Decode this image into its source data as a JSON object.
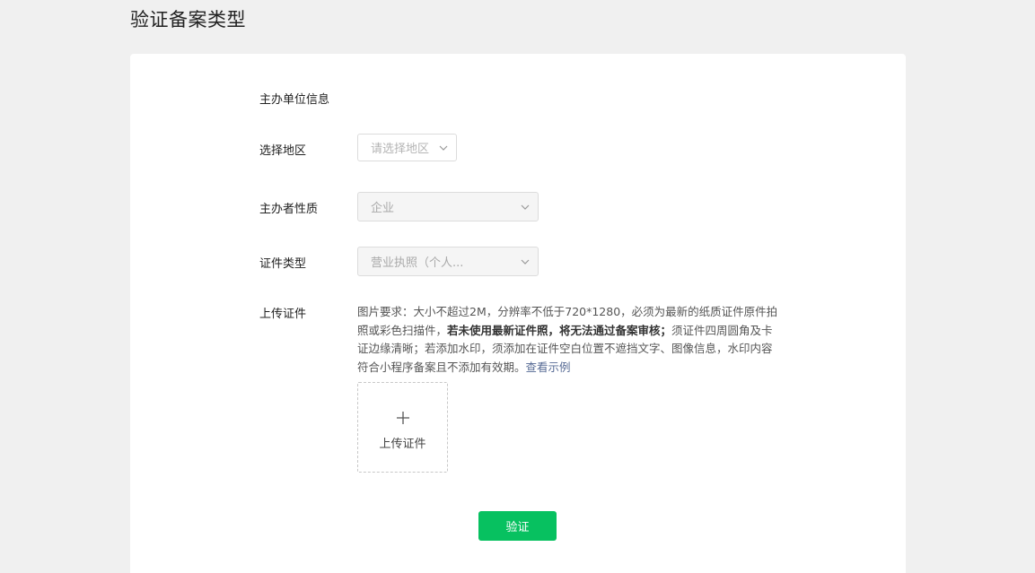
{
  "page": {
    "title": "验证备案类型"
  },
  "form": {
    "section_title": "主办单位信息",
    "region": {
      "label": "选择地区",
      "placeholder": "请选择地区"
    },
    "nature": {
      "label": "主办者性质",
      "value": "企业"
    },
    "cert_type": {
      "label": "证件类型",
      "value": "营业执照（个人..."
    },
    "upload": {
      "label": "上传证件",
      "requirements_part1": "图片要求：大小不超过2M，分辨率不低于720*1280，必须为最新的纸质证件原件拍照或彩色扫描件，",
      "requirements_bold": "若未使用最新证件照，将无法通过备案审核；",
      "requirements_part2": "须证件四周圆角及卡证边缘清晰；若添加水印，须添加在证件空白位置不遮挡文字、图像信息，水印内容符合小程序备案且不添加有效期。",
      "example_link": "查看示例",
      "box_label": "上传证件"
    },
    "submit_label": "验证"
  },
  "icons": {
    "dropdown": "chevron-down-icon",
    "upload": "plus-icon"
  },
  "colors": {
    "primary_button": "#07c160",
    "link": "#576b95",
    "background": "#f0f0f0"
  }
}
